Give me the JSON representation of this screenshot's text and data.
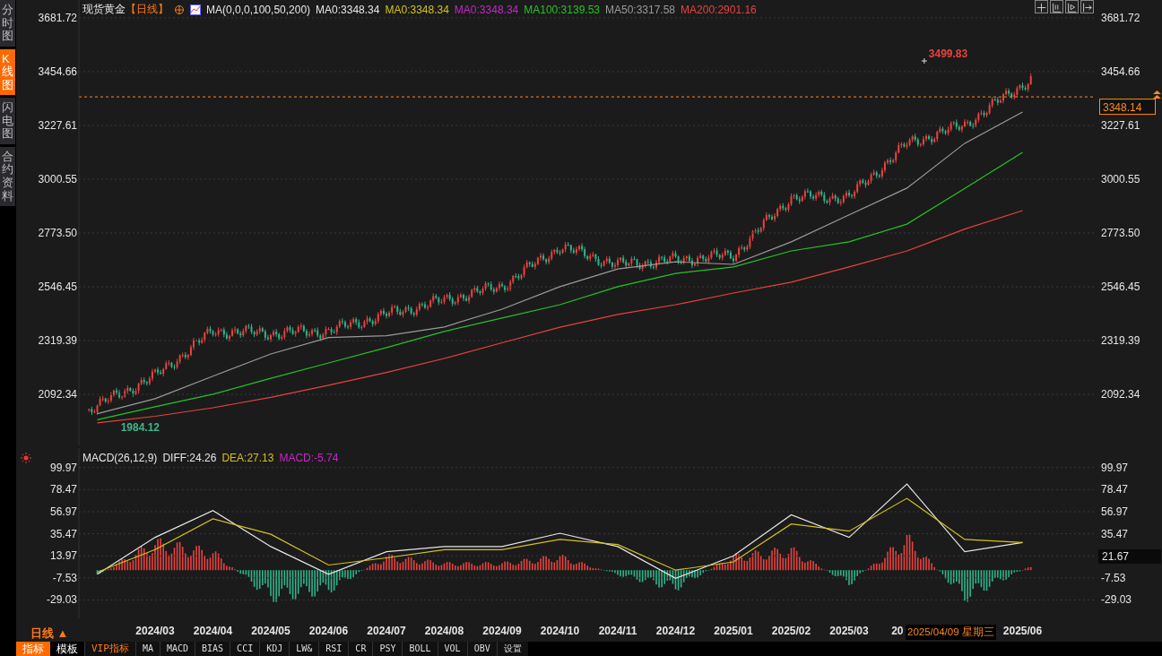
{
  "sidebar": {
    "tabs": [
      {
        "label": "分时图",
        "selected": false
      },
      {
        "label": "K线图",
        "selected": true
      },
      {
        "label": "闪电图",
        "selected": false
      },
      {
        "label": "合约资料",
        "selected": false
      }
    ]
  },
  "price_panel": {
    "title": "现货黄金",
    "period": "【日线】",
    "indicator": "MA(0,0,0,100,50,200)",
    "legend": [
      {
        "label": "MA0:3348.34",
        "color": "#e6e6e6"
      },
      {
        "label": "MA0:3348.34",
        "color": "#d4c21c"
      },
      {
        "label": "MA0:3348.34",
        "color": "#c627c6"
      },
      {
        "label": "MA100:3139.53",
        "color": "#26c226"
      },
      {
        "label": "MA50:3317.58",
        "color": "#9a9a9a"
      },
      {
        "label": "MA200:2901.16",
        "color": "#e8423f"
      }
    ],
    "right_axis_labels": [
      "3681.72",
      "3454.66",
      "3227.61",
      "3000.55",
      "2773.50",
      "2546.45",
      "2319.39",
      "2092.34"
    ],
    "last_price": "3348.14",
    "chart_data": {
      "type": "line",
      "categories": [
        null,
        null,
        null,
        null,
        null,
        null,
        null,
        null,
        null,
        null,
        null,
        null,
        null,
        null,
        null,
        null,
        null
      ],
      "series": [
        {
          "color": "#26c226",
          "values": [
            1985,
            2040,
            2093,
            2160,
            2225,
            2290,
            2358,
            2415,
            2471,
            2547,
            2603,
            2630,
            2698,
            2736,
            2811,
            2962,
            3114
          ]
        },
        {
          "color": "#9a9a9a",
          "values": [
            2011,
            2074,
            2169,
            2263,
            2332,
            2340,
            2377,
            2452,
            2547,
            2622,
            2652,
            2641,
            2736,
            2850,
            2963,
            3152,
            3284
          ]
        },
        {
          "color": "#e8423f",
          "values": [
            1972,
            2000,
            2036,
            2080,
            2131,
            2185,
            2244,
            2310,
            2376,
            2430,
            2471,
            2520,
            2566,
            2630,
            2698,
            2790,
            2868
          ]
        }
      ],
      "ylim": [
        1877,
        3757
      ],
      "grid": true,
      "yticks": [
        {
          "value": 3681.72,
          "label": "3681.72"
        },
        {
          "value": 3454.66,
          "label": "3454.66"
        },
        {
          "value": 3227.61,
          "label": "3227.61"
        },
        {
          "value": 3000.55,
          "label": "3000.55"
        },
        {
          "value": 2773.5,
          "label": "2773.50"
        },
        {
          "value": 2546.45,
          "label": "2546.45"
        },
        {
          "value": 2319.39,
          "label": "2319.39"
        },
        {
          "value": 2092.34,
          "label": "2092.34"
        }
      ],
      "annotations": [
        "3499.83",
        "1984.12"
      ]
    }
  },
  "macd_panel": {
    "indicator": "MACD(26,12,9)",
    "legend": [
      {
        "label": "DIFF:24.26",
        "color": "#e6e6e6"
      },
      {
        "label": "DEA:27.13",
        "color": "#d4c21c"
      },
      {
        "label": "MACD:-5.74",
        "color": "#c627c6"
      }
    ],
    "right_axis_labels": [
      "99.97",
      "78.47",
      "56.97",
      "35.47",
      "-7.53",
      "-29.03"
    ],
    "last_value": "21.67",
    "chart_data": {
      "type": "line",
      "categories": [
        null,
        "2024/03",
        "2024/04",
        "2024/05",
        "2024/06",
        "2024/07",
        "2024/08",
        "2024/09",
        "2024/10",
        "2024/11",
        "2024/12",
        "2025/01",
        "2025/02",
        "2025/03",
        "20",
        null,
        "2025/06"
      ],
      "series": [
        {
          "color": "#e6e6e6",
          "values": [
            -4,
            32,
            58,
            23,
            -4,
            18,
            23,
            23,
            36,
            23,
            -8,
            14,
            54,
            32,
            84,
            18,
            27
          ]
        },
        {
          "color": "#d4c21c",
          "values": [
            -2,
            20,
            50,
            35,
            5,
            12,
            20,
            20,
            30,
            25,
            0,
            8,
            45,
            38,
            70,
            30,
            27
          ]
        }
      ],
      "ylim": [
        -47,
        119
      ],
      "grid": true,
      "yticks": [
        {
          "value": 99.97,
          "label": "99.97"
        },
        {
          "value": 78.47,
          "label": "78.47"
        },
        {
          "value": 56.97,
          "label": "56.97"
        },
        {
          "value": 35.47,
          "label": "35.47"
        },
        {
          "value": 13.97,
          "label": "13.97"
        },
        {
          "value": -7.53,
          "label": "-7.53"
        },
        {
          "value": -29.03,
          "label": "-29.03"
        }
      ]
    }
  },
  "cursor_label": {
    "date": "2025/04/09",
    "weekday": "星期三"
  },
  "period_selector": "日线 ▲",
  "bottom_tabs": [
    {
      "label": "指标",
      "selected": true
    },
    {
      "label": "模板",
      "selected": false
    }
  ],
  "indicator_buttons": [
    {
      "label": "VIP指标",
      "kind": "vip"
    },
    {
      "label": "MA",
      "kind": "plain"
    },
    {
      "label": "MACD",
      "kind": "plain"
    },
    {
      "label": "BIAS",
      "kind": "plain"
    },
    {
      "label": "CCI",
      "kind": "plain"
    },
    {
      "label": "KDJ",
      "kind": "plain"
    },
    {
      "label": "LW&",
      "kind": "plain"
    },
    {
      "label": "RSI",
      "kind": "plain"
    },
    {
      "label": "CR",
      "kind": "plain"
    },
    {
      "label": "PSY",
      "kind": "plain"
    },
    {
      "label": "BOLL",
      "kind": "plain"
    },
    {
      "label": "VOL",
      "kind": "plain"
    },
    {
      "label": "OBV",
      "kind": "plain"
    },
    {
      "label": "设置",
      "kind": "plain"
    }
  ]
}
